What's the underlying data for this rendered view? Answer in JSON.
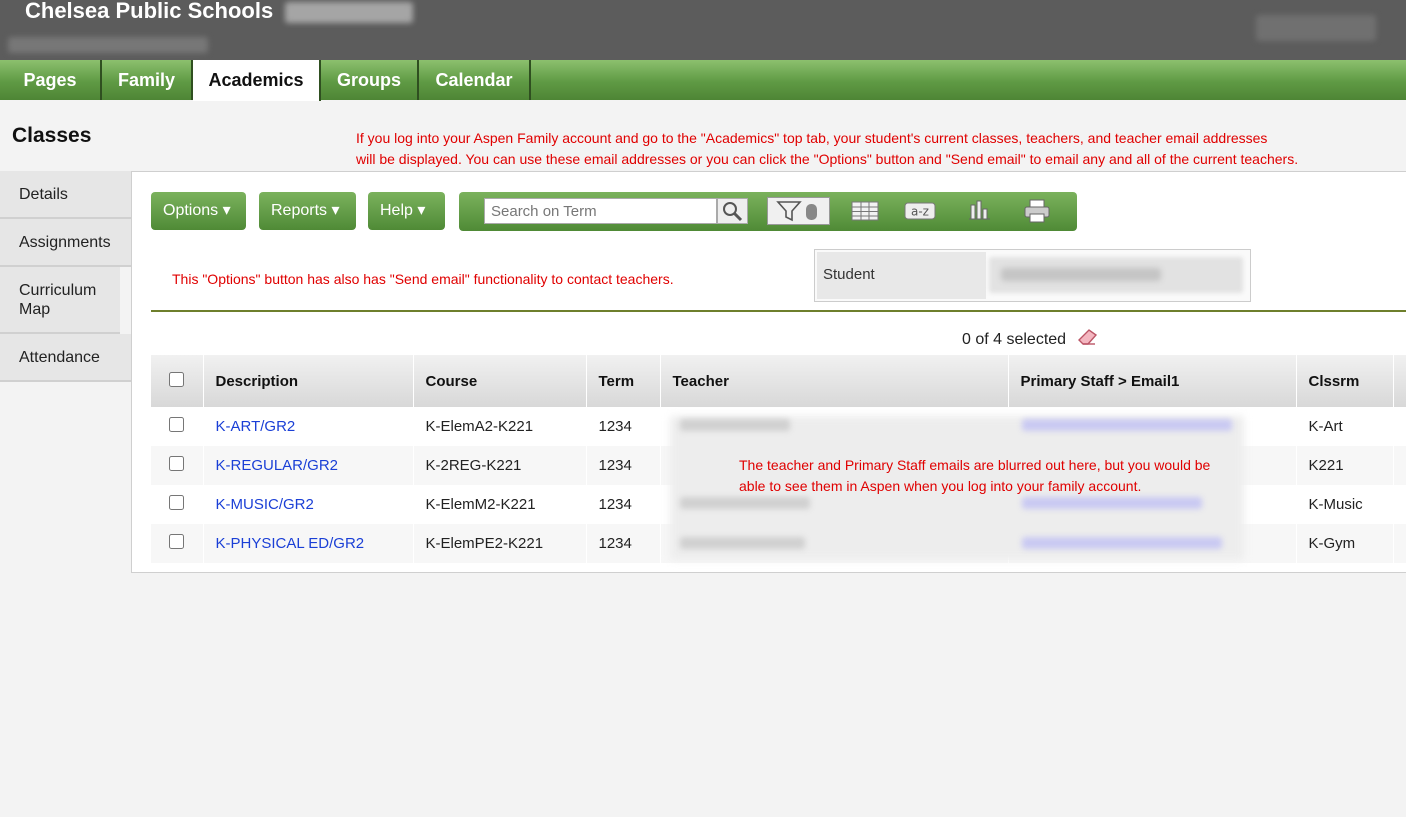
{
  "header": {
    "school_name": "Chelsea Public Schools"
  },
  "tabs": [
    "Pages",
    "Family",
    "Academics",
    "Groups",
    "Calendar"
  ],
  "active_tab": "Academics",
  "page_title": "Classes",
  "top_note_line1": "If you log into your Aspen Family account and go to the \"Academics\" top tab, your student's current classes, teachers, and teacher email addresses",
  "top_note_line2": "will be displayed. You can use these email addresses or you can click the \"Options\" button and \"Send email\" to email any and all of the current teachers.",
  "side_nav": [
    "Details",
    "Assignments",
    "Curriculum Map",
    "Attendance"
  ],
  "toolbar": {
    "options_label": "Options",
    "reports_label": "Reports",
    "help_label": "Help",
    "search_placeholder": "Search on Term"
  },
  "options_note": "This \"Options\" button has also has \"Send email\" functionality to contact teachers.",
  "student_label": "Student",
  "selected_count": "0 of 4 selected",
  "table": {
    "columns": [
      "Description",
      "Course",
      "Term",
      "Teacher",
      "Primary Staff > Email1",
      "Clssrm"
    ],
    "rows": [
      {
        "description": "K-ART/GR2",
        "course": "K-ElemA2-K221",
        "term": "1234",
        "room": "K-Art"
      },
      {
        "description": "K-REGULAR/GR2",
        "course": "K-2REG-K221",
        "term": "1234",
        "room": "K221"
      },
      {
        "description": "K-MUSIC/GR2",
        "course": "K-ElemM2-K221",
        "term": "1234",
        "room": "K-Music"
      },
      {
        "description": "K-PHYSICAL ED/GR2",
        "course": "K-ElemPE2-K221",
        "term": "1234",
        "room": "K-Gym"
      }
    ]
  },
  "blur_note_line1": "The teacher and Primary Staff emails are blurred out here, but you would be",
  "blur_note_line2": "able to see them in Aspen when you log into your family account."
}
